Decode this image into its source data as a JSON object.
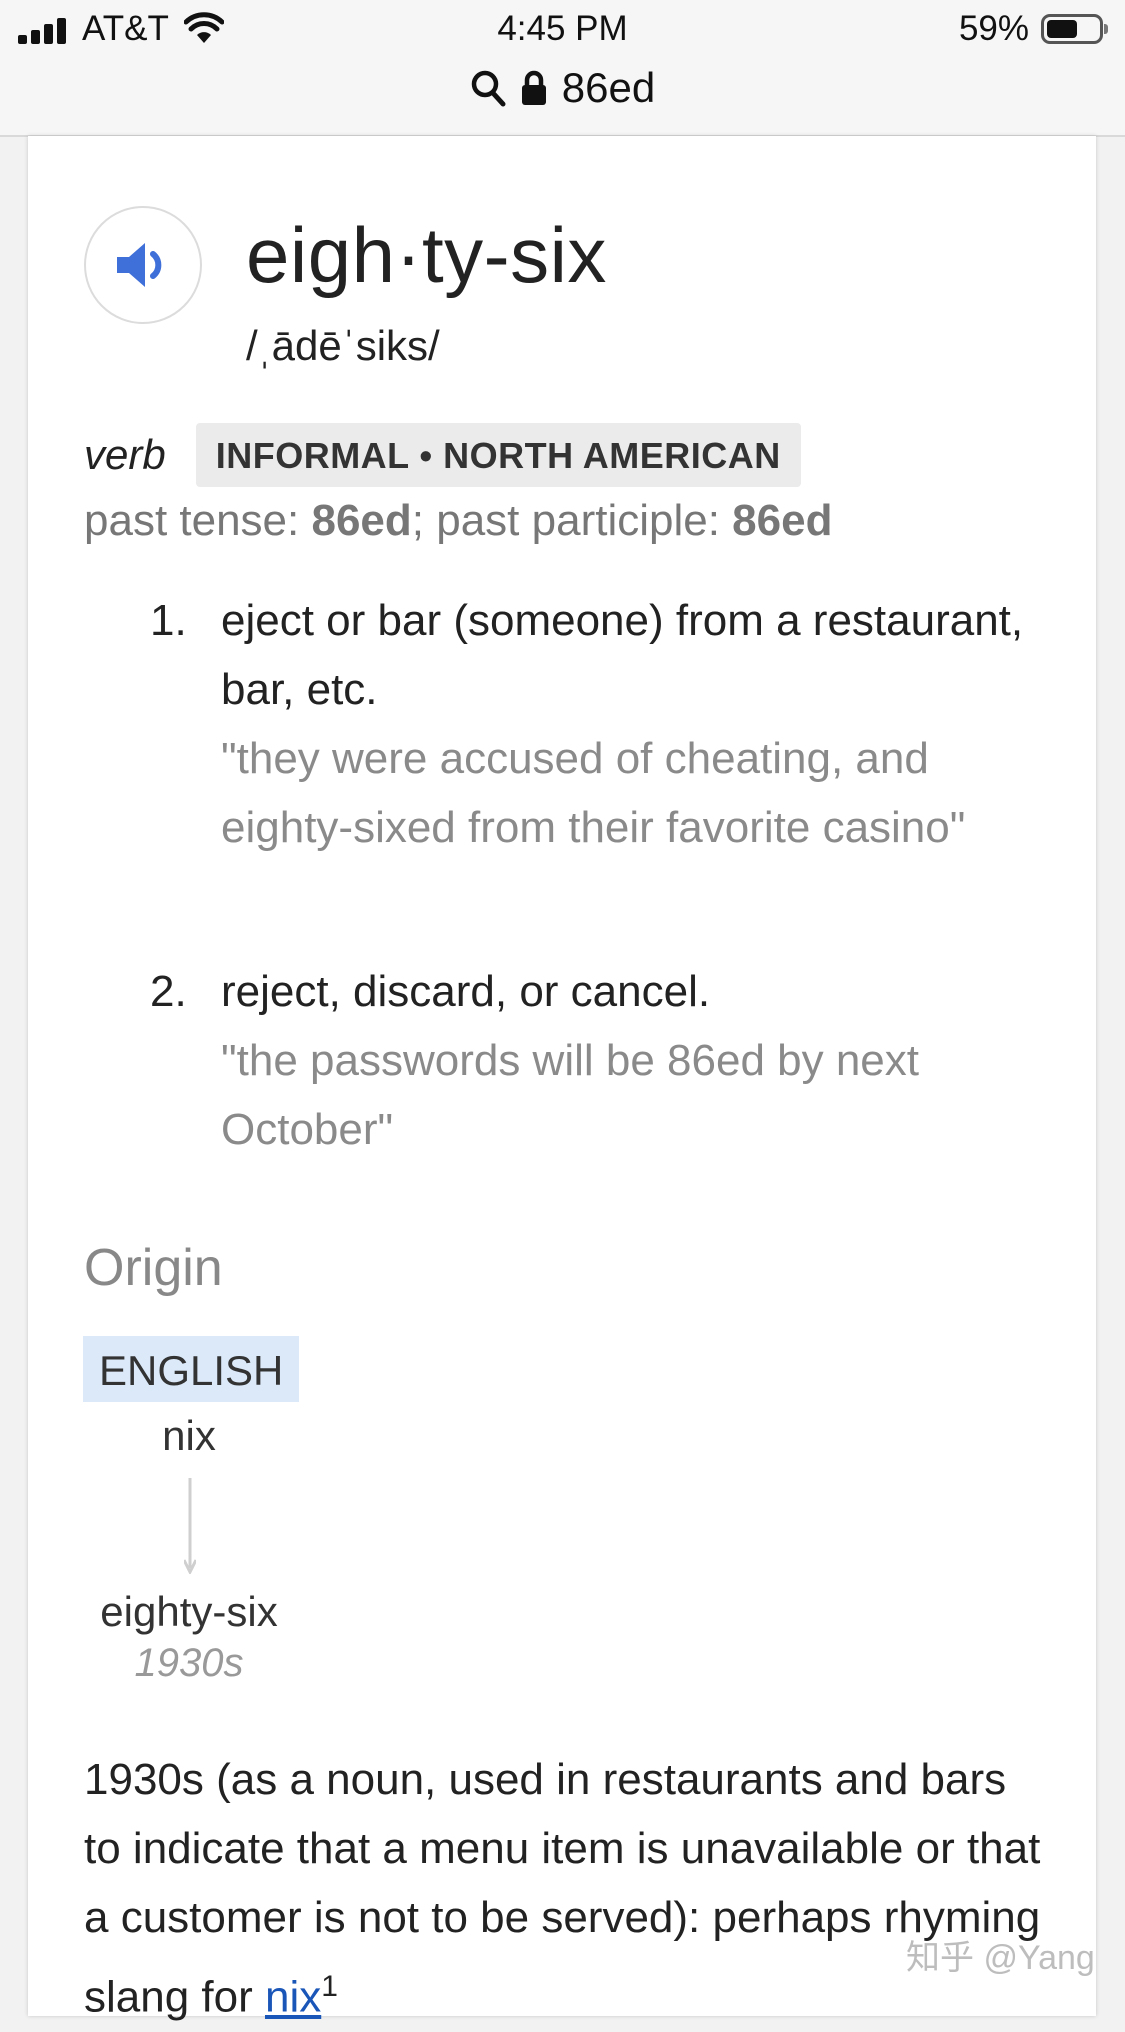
{
  "status_bar": {
    "carrier": "AT&T",
    "time": "4:45 PM",
    "battery_percent": "59%",
    "battery_level": 0.59,
    "signal_bars": 4,
    "icons": [
      "signal-icon",
      "wifi-icon",
      "battery-icon"
    ]
  },
  "address_bar": {
    "icons": [
      "search-icon",
      "lock-icon"
    ],
    "url": "86ed"
  },
  "entry": {
    "audio_icon": "speaker-icon",
    "headword": "eigh·ty-six",
    "pronunciation": "/ˌādēˈsiks/",
    "part_of_speech": "verb",
    "register_label": "INFORMAL • NORTH AMERICAN",
    "inflections": {
      "past_label": "past tense: ",
      "past_value": "86ed",
      "sep": "; past participle: ",
      "participle_value": "86ed"
    },
    "senses": [
      {
        "number": "1.",
        "definition": "eject or bar (someone) from a restaurant, bar, etc.",
        "example": "\"they were accused of cheating, and eighty-sixed from their favorite casino\""
      },
      {
        "number": "2.",
        "definition": "reject, discard, or cancel.",
        "example": "\"the passwords will be 86ed by next October\""
      }
    ]
  },
  "origin": {
    "heading": "Origin",
    "language": "ENGLISH",
    "source_word": "nix",
    "target_word": "eighty-six",
    "date": "1930s",
    "arrow_icon": "down-arrow-icon",
    "text_before": "1930s (as a noun, used in restaurants and bars to indicate that a menu item is unavailable or that a customer is not to be served): perhaps rhyming slang for ",
    "link_text": "nix",
    "superscript": "1"
  },
  "watermark": "知乎 @Yang"
}
